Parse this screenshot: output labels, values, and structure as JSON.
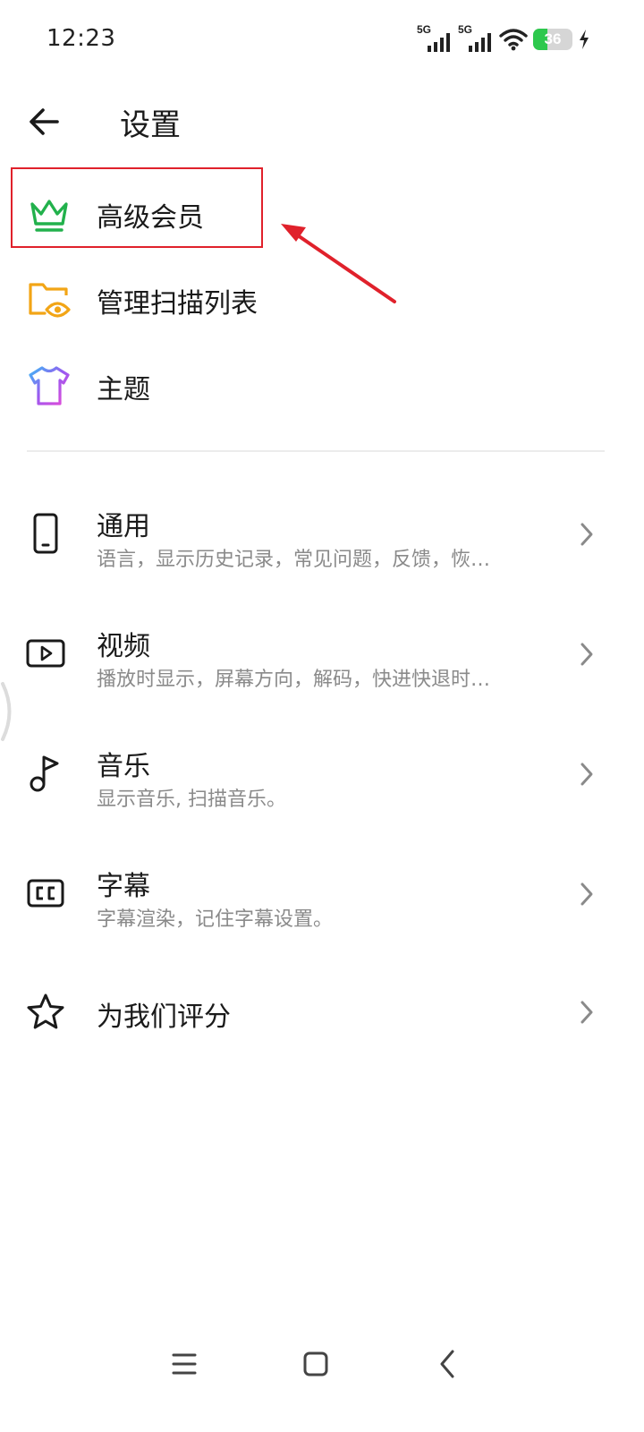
{
  "status_bar": {
    "time": "12:23",
    "networks": [
      "5G",
      "5G"
    ],
    "battery_level": "36",
    "battery_fraction": 0.36,
    "icons": [
      "signal-icon",
      "signal-icon",
      "wifi-icon",
      "battery-icon",
      "charging-icon"
    ]
  },
  "header": {
    "title": "设置",
    "back_icon": "back-arrow-icon"
  },
  "top_items": [
    {
      "label": "高级会员",
      "icon": "crown-icon",
      "color": "#22b14c"
    },
    {
      "label": "管理扫描列表",
      "icon": "folder-eye-icon",
      "color": "#f2a516"
    },
    {
      "label": "主题",
      "icon": "tshirt-icon",
      "color": "#9b59f0"
    }
  ],
  "settings": [
    {
      "title": "通用",
      "subtitle": "语言，显示历史记录，常见问题，反馈，恢…",
      "icon": "phone-icon"
    },
    {
      "title": "视频",
      "subtitle": "播放时显示，屏幕方向，解码，快进快退时…",
      "icon": "video-play-icon"
    },
    {
      "title": "音乐",
      "subtitle": "显示音乐, 扫描音乐。",
      "icon": "music-note-icon"
    },
    {
      "title": "字幕",
      "subtitle": "字幕渲染，记住字幕设置。",
      "icon": "cc-icon"
    },
    {
      "title": "为我们评分",
      "icon": "star-icon"
    }
  ],
  "colors": {
    "annotation": "#e0212b",
    "accent_green": "#22b14c",
    "text_primary": "#1a1a1a",
    "text_secondary": "#8a8a8a"
  },
  "nav_bar": {
    "buttons": [
      "menu-icon",
      "home-icon",
      "back-icon"
    ]
  }
}
